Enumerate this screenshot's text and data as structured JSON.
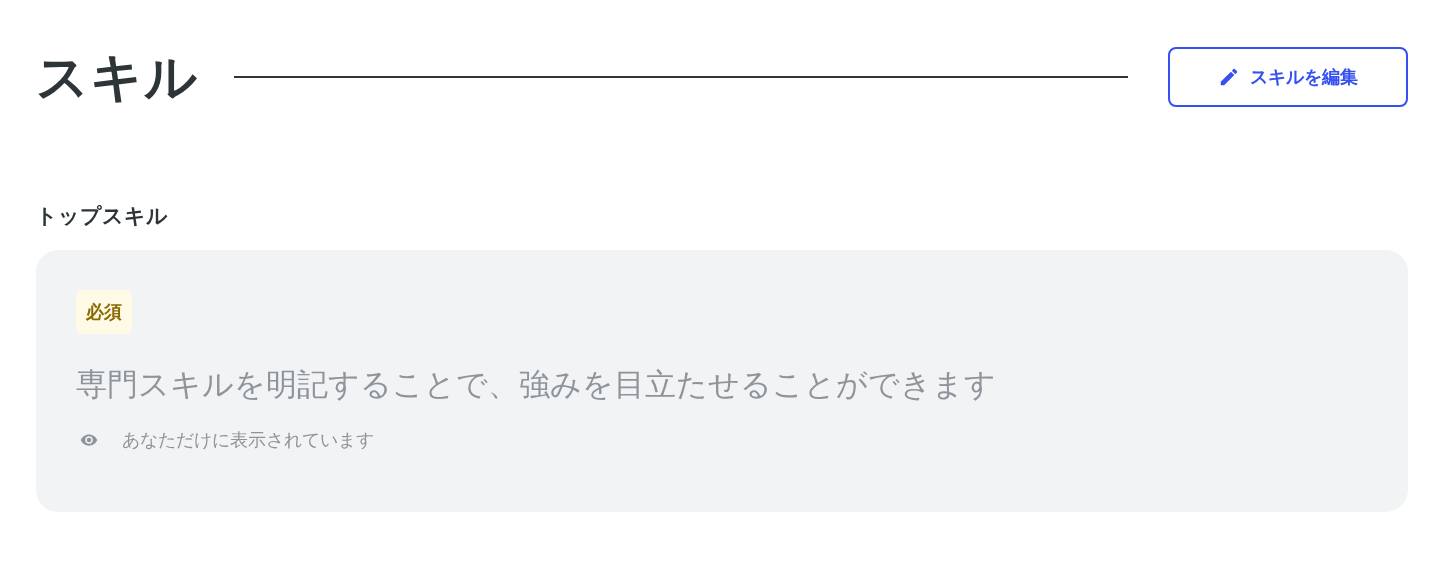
{
  "section": {
    "title": "スキル",
    "edit_button": "スキルを編集"
  },
  "top_skills": {
    "heading": "トップスキル",
    "badge": "必須",
    "prompt": "専門スキルを明記することで、強みを目立たせることができます",
    "visibility_note": "あなただけに表示されています"
  }
}
